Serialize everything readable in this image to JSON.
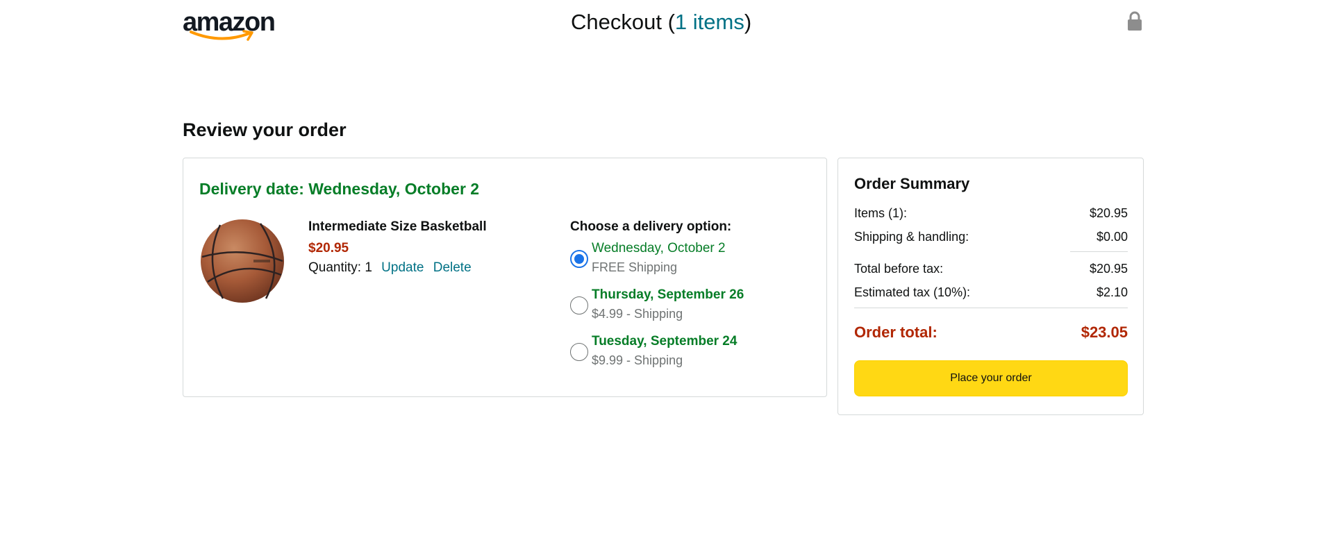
{
  "header": {
    "logo_text": "amazon",
    "checkout_prefix": "Checkout (",
    "checkout_count": "1 items",
    "checkout_suffix": ")",
    "lock_icon": "lock-icon"
  },
  "review": {
    "heading": "Review your order"
  },
  "order": {
    "delivery_date": "Delivery date: Wednesday, October 2",
    "product": {
      "image_icon": "basketball-image",
      "name": "Intermediate Size Basketball",
      "price": "$20.95",
      "quantity_label": "Quantity: 1",
      "update_link": "Update",
      "delete_link": "Delete"
    },
    "delivery_options": {
      "title": "Choose a delivery option:",
      "options": [
        {
          "date": "Wednesday, October 2",
          "cost": "FREE Shipping",
          "selected": true
        },
        {
          "date": "Thursday, September 26",
          "cost": "$4.99 - Shipping",
          "selected": false
        },
        {
          "date": "Tuesday, September 24",
          "cost": "$9.99 - Shipping",
          "selected": false
        }
      ]
    }
  },
  "summary": {
    "title": "Order Summary",
    "rows": [
      {
        "label": "Items (1):",
        "value": "$20.95"
      },
      {
        "label": "Shipping & handling:",
        "value": "$0.00"
      },
      {
        "label": "Total before tax:",
        "value": "$20.95"
      },
      {
        "label": "Estimated tax (10%):",
        "value": "$2.10"
      }
    ],
    "total_label": "Order total:",
    "total_value": "$23.05",
    "place_order_label": "Place your order"
  },
  "colors": {
    "link": "#007185",
    "green": "#067d27",
    "price_red": "#b12704",
    "button_yellow": "#ffd814",
    "radio_blue": "#1a73e8"
  }
}
